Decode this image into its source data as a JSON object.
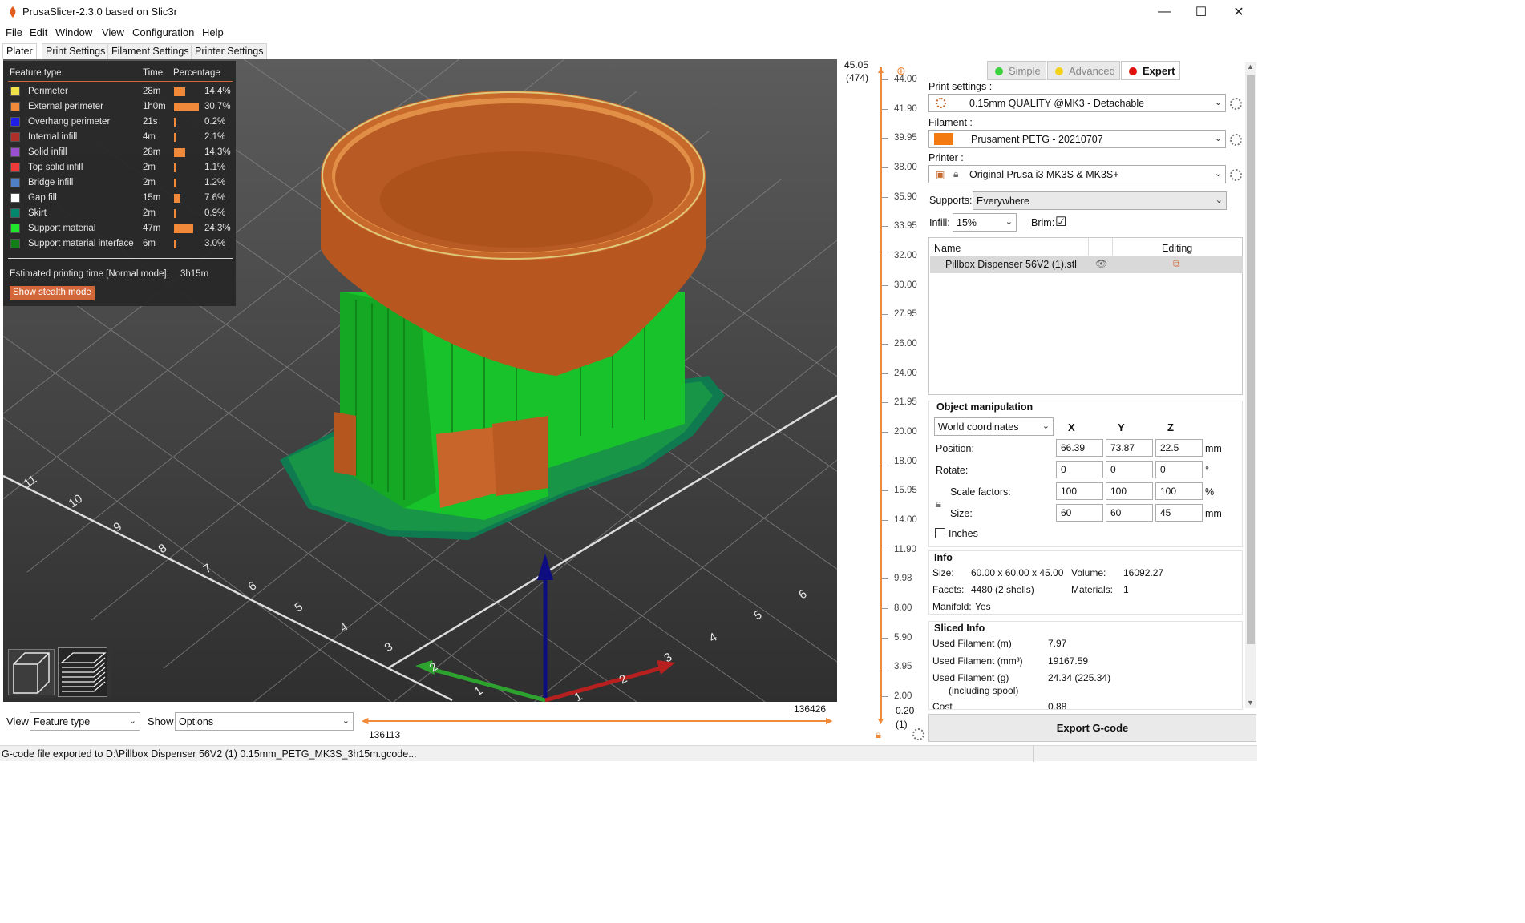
{
  "window": {
    "title": "PrusaSlicer-2.3.0 based on Slic3r",
    "minimize": "—",
    "maximize": "☐",
    "close": "✕"
  },
  "menu": [
    "File",
    "Edit",
    "Window",
    "View",
    "Configuration",
    "Help"
  ],
  "tabs": [
    "Plater",
    "Print Settings",
    "Filament Settings",
    "Printer Settings"
  ],
  "legend": {
    "headers": {
      "feature": "Feature type",
      "time": "Time",
      "percentage": "Percentage"
    },
    "rows": [
      {
        "name": "Perimeter",
        "time": "28m",
        "pct": "14.4%",
        "color": "#f2e24a",
        "frac": 0.144
      },
      {
        "name": "External perimeter",
        "time": "1h0m",
        "pct": "30.7%",
        "color": "#f08a3a",
        "frac": 0.307
      },
      {
        "name": "Overhang perimeter",
        "time": "21s",
        "pct": "0.2%",
        "color": "#1f1fe6",
        "frac": 0.002
      },
      {
        "name": "Internal infill",
        "time": "4m",
        "pct": "2.1%",
        "color": "#b03029",
        "frac": 0.021
      },
      {
        "name": "Solid infill",
        "time": "28m",
        "pct": "14.3%",
        "color": "#9a4fd1",
        "frac": 0.143
      },
      {
        "name": "Top solid infill",
        "time": "2m",
        "pct": "1.1%",
        "color": "#f03a3a",
        "frac": 0.011
      },
      {
        "name": "Bridge infill",
        "time": "2m",
        "pct": "1.2%",
        "color": "#4f7fc4",
        "frac": 0.012
      },
      {
        "name": "Gap fill",
        "time": "15m",
        "pct": "7.6%",
        "color": "#ffffff",
        "frac": 0.076
      },
      {
        "name": "Skirt",
        "time": "2m",
        "pct": "0.9%",
        "color": "#00876e",
        "frac": 0.009
      },
      {
        "name": "Support material",
        "time": "47m",
        "pct": "24.3%",
        "color": "#1fe62b",
        "frac": 0.243
      },
      {
        "name": "Support material interface",
        "time": "6m",
        "pct": "3.0%",
        "color": "#128017",
        "frac": 0.03
      }
    ],
    "estimated_label": "Estimated printing time [Normal mode]:",
    "estimated_value": "3h15m",
    "stealth_button": "Show stealth mode"
  },
  "axis_numbers": [
    "11",
    "10",
    "9",
    "8",
    "7",
    "6",
    "5",
    "4",
    "3",
    "2",
    "1",
    "6",
    "5",
    "4",
    "3",
    "2",
    "1"
  ],
  "vertical_slider": {
    "top_value": "45.05",
    "top_layer": "(474)",
    "bottom_value": "0.20",
    "bottom_layer": "(1)",
    "ticks": [
      "44.00",
      "41.90",
      "39.95",
      "38.00",
      "35.90",
      "33.95",
      "32.00",
      "30.00",
      "27.95",
      "26.00",
      "24.00",
      "21.95",
      "20.00",
      "18.00",
      "15.95",
      "14.00",
      "11.90",
      "9.98",
      "8.00",
      "5.90",
      "3.95",
      "2.00"
    ]
  },
  "horizontal_slider": {
    "left_value": "136113",
    "right_value": "136426"
  },
  "bottom_controls": {
    "view_label": "View",
    "view_value": "Feature type",
    "show_label": "Show",
    "show_value": "Options"
  },
  "modes": {
    "simple": "Simple",
    "advanced": "Advanced",
    "expert": "Expert"
  },
  "print_settings": {
    "label": "Print settings :",
    "value": "0.15mm QUALITY @MK3 - Detachable"
  },
  "filament": {
    "label": "Filament :",
    "value": "Prusament PETG - 20210707",
    "color": "#f27a10"
  },
  "printer": {
    "label": "Printer :",
    "value": "Original Prusa i3 MK3S & MK3S+"
  },
  "supports": {
    "label": "Supports:",
    "value": "Everywhere"
  },
  "infill": {
    "label": "Infill:",
    "value": "15%"
  },
  "brim": {
    "label": "Brim:",
    "checked": "☑"
  },
  "object_list": {
    "col_name": "Name",
    "col_editing": "Editing",
    "items": [
      {
        "name": "Pillbox Dispenser 56V2 (1).stl"
      }
    ]
  },
  "object_manipulation": {
    "title": "Object manipulation",
    "coords": "World coordinates",
    "axes": [
      "X",
      "Y",
      "Z"
    ],
    "position": {
      "label": "Position:",
      "x": "66.39",
      "y": "73.87",
      "z": "22.5",
      "unit": "mm"
    },
    "rotate": {
      "label": "Rotate:",
      "x": "0",
      "y": "0",
      "z": "0",
      "unit": "°"
    },
    "scale": {
      "label": "Scale factors:",
      "x": "100",
      "y": "100",
      "z": "100",
      "unit": "%"
    },
    "size": {
      "label": "Size:",
      "x": "60",
      "y": "60",
      "z": "45",
      "unit": "mm"
    },
    "inches": "Inches"
  },
  "info": {
    "title": "Info",
    "size_label": "Size:",
    "size_value": "60.00 x 60.00 x 45.00",
    "volume_label": "Volume:",
    "volume_value": "16092.27",
    "facets_label": "Facets:",
    "facets_value": "4480 (2 shells)",
    "materials_label": "Materials:",
    "materials_value": "1",
    "manifold_label": "Manifold:",
    "manifold_value": "Yes"
  },
  "sliced_info": {
    "title": "Sliced Info",
    "rows": [
      {
        "label": "Used Filament (m)",
        "value": "7.97"
      },
      {
        "label": "Used Filament (mm³)",
        "value": "19167.59"
      },
      {
        "label": "Used Filament (g)",
        "value": "24.34 (225.34)"
      },
      {
        "label": "(including spool)",
        "value": ""
      },
      {
        "label": "Cost",
        "value": "0.88"
      }
    ]
  },
  "export_button": "Export G-code",
  "status": "G-code file exported to D:\\Pillbox Dispenser 56V2 (1) 0.15mm_PETG_MK3S_3h15m.gcode..."
}
